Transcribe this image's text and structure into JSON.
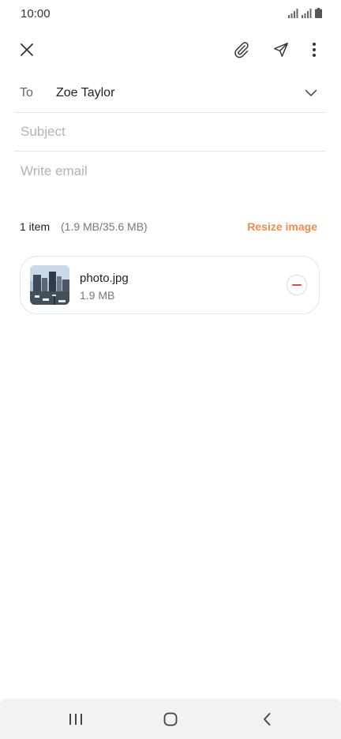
{
  "status": {
    "time": "10:00"
  },
  "toolbar": {
    "close_icon": "close-icon",
    "attach_icon": "paperclip-icon",
    "send_icon": "send-icon",
    "more_icon": "more-vertical-icon"
  },
  "compose": {
    "to_label": "To",
    "to_value": "Zoe Taylor",
    "subject_placeholder": "Subject",
    "body_placeholder": "Write email"
  },
  "attachments": {
    "count": "1 item",
    "size_summary": "(1.9 MB/35.6 MB)",
    "resize_label": "Resize image",
    "items": [
      {
        "name": "photo.jpg",
        "size": "1.9 MB"
      }
    ]
  },
  "colors": {
    "accent": "#f08c4a",
    "remove": "#e0454c"
  }
}
